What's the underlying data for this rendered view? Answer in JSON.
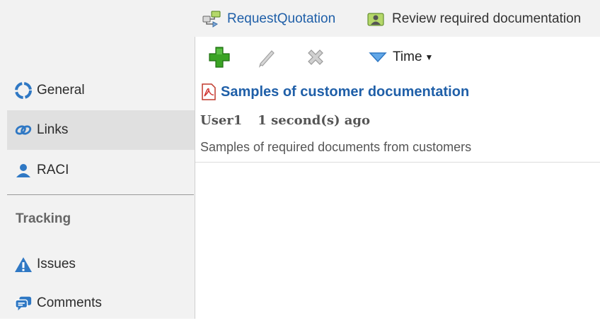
{
  "breadcrumbs": [
    {
      "label": "RequestQuotation",
      "icon": "process-flow-icon"
    },
    {
      "label": "Review required documentation",
      "icon": "user-task-icon"
    }
  ],
  "sidebar": {
    "items": [
      {
        "label": "General",
        "icon": "general-icon",
        "active": false
      },
      {
        "label": "Links",
        "icon": "link-icon",
        "active": true
      },
      {
        "label": "RACI",
        "icon": "person-icon",
        "active": false
      }
    ],
    "tracking": {
      "title": "Tracking",
      "items": [
        {
          "label": "Issues",
          "icon": "warning-icon"
        },
        {
          "label": "Comments",
          "icon": "comments-icon"
        }
      ]
    }
  },
  "toolbar": {
    "add": "add-icon",
    "edit": "edit-icon",
    "delete": "delete-icon",
    "sort_label": "Time"
  },
  "links": [
    {
      "title": "Samples of customer documentation",
      "user": "User1",
      "time": "1 second(s) ago",
      "description": "Samples of required documents from customers"
    }
  ],
  "colors": {
    "link": "#1f5fa8",
    "add_green": "#3aa324",
    "sidebar_bg": "#f2f2f2",
    "active_bg": "#e0e0e0"
  }
}
